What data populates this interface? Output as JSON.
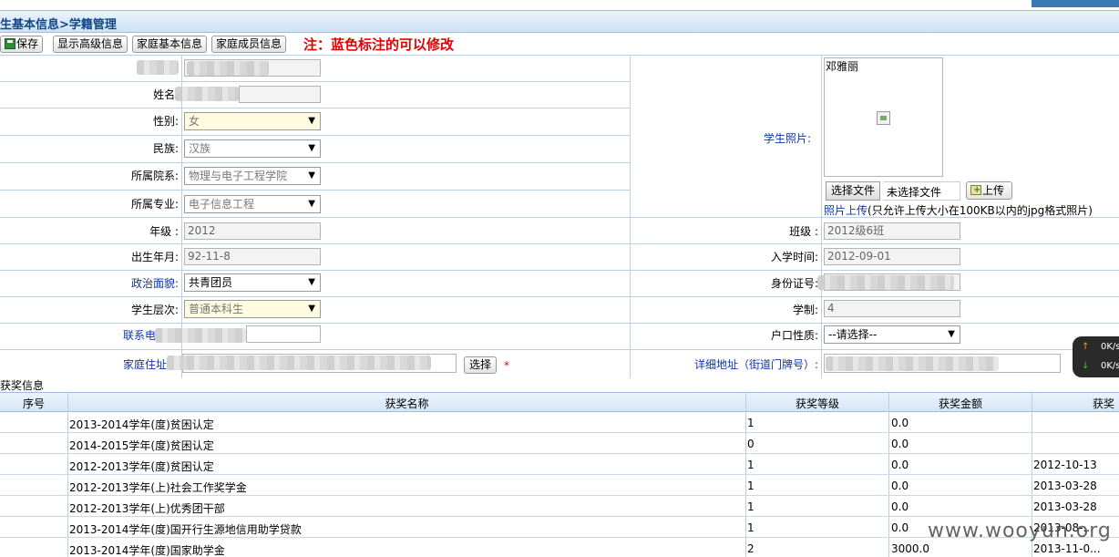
{
  "title": "生基本信息>学籍管理",
  "toolbar": {
    "save": "保存",
    "advanced": "显示高级信息",
    "family_basic": "家庭基本信息",
    "family_members": "家庭成员信息",
    "note": "注：蓝色标注的可以修改"
  },
  "form": {
    "name_label": "姓名.",
    "gender_label": "性别:",
    "gender_value": "女",
    "ethnicity_label": "民族:",
    "ethnicity_value": "汉族",
    "college_label": "所属院系:",
    "college_value": "物理与电子工程学院",
    "major_label": "所属专业:",
    "major_value": "电子信息工程",
    "grade_label": "年级 :",
    "grade_value": "2012",
    "birth_label": "出生年月:",
    "birth_value": "92-11-8",
    "political_label": "政治面貌:",
    "political_value": "共青团员",
    "level_label": "学生层次:",
    "level_value": "普通本科生",
    "phone_label": "联系电",
    "address_label": "家庭住址",
    "pick_button": "选择",
    "required_mark": "*",
    "photo_label": "学生照片:",
    "photo_name": "邓雅丽",
    "file_button": "选择文件",
    "file_status": "未选择文件",
    "upload_button": "上传",
    "upload_link": "照片上传",
    "upload_hint": "(只允许上传大小在100KB以内的jpg格式照片)",
    "class_label": "班级 :",
    "class_value": "2012级6班",
    "enroll_label": "入学时间:",
    "enroll_value": "2012-09-01",
    "id_label": "身份证号:",
    "duration_label": "学制:",
    "duration_value": "4",
    "household_label": "户口性质:",
    "household_value": "--请选择--",
    "detail_label": "详细地址（街道门牌号）:"
  },
  "speed": {
    "up": "0K/s",
    "down": "0K/s"
  },
  "awards": {
    "section_title": "获奖信息",
    "headers": [
      "序号",
      "获奖名称",
      "获奖等级",
      "获奖金额",
      "获奖"
    ],
    "rows": [
      [
        "",
        "2013-2014学年(度)贫困认定",
        "1",
        "0.0",
        ""
      ],
      [
        "",
        "2014-2015学年(度)贫困认定",
        "0",
        "0.0",
        ""
      ],
      [
        "",
        "2012-2013学年(度)贫困认定",
        "1",
        "0.0",
        "2012-10-13"
      ],
      [
        "",
        "2012-2013学年(上)社会工作奖学金",
        "1",
        "0.0",
        "2013-03-28"
      ],
      [
        "",
        "2012-2013学年(上)优秀团干部",
        "1",
        "0.0",
        "2013-03-28"
      ],
      [
        "",
        "2013-2014学年(度)国开行生源地信用助学贷款",
        "1",
        "0.0",
        "2013-08-..."
      ],
      [
        "",
        "2013-2014学年(度)国家助学金",
        "2",
        "3000.0",
        "2013-11-0..."
      ]
    ]
  },
  "watermark": "www.wooyun.org"
}
